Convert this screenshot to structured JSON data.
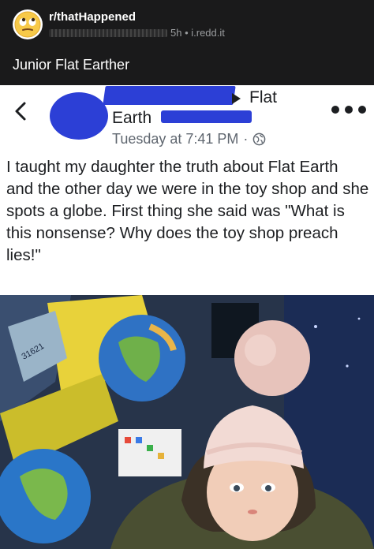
{
  "header": {
    "subreddit": "r/thatHappened",
    "meta": "5h • i.redd.it",
    "title": "Junior Flat Earther"
  },
  "fb_post": {
    "group_line_1": "Flat",
    "group_line_2": "Earth",
    "timestamp": "Tuesday at 7:41 PM",
    "body": "I taught my daughter the truth about Flat Earth and the other day we were in the toy shop and she spots a globe. First thing she said was \"What is this nonsense? Why does the toy shop preach lies!\""
  },
  "photo": {
    "shelf_label": "31621"
  },
  "icons": {
    "subreddit_avatar": "rolling-eyes-emoji",
    "back": "chevron-left-icon",
    "arrow": "triangle-right-icon",
    "privacy": "globe-icon",
    "more": "ellipsis-icon"
  },
  "colors": {
    "reddit_bg": "#1a1a1b",
    "redaction_blue": "#2c3fd6",
    "fb_text": "#1c1e21",
    "fb_meta": "#606770"
  }
}
